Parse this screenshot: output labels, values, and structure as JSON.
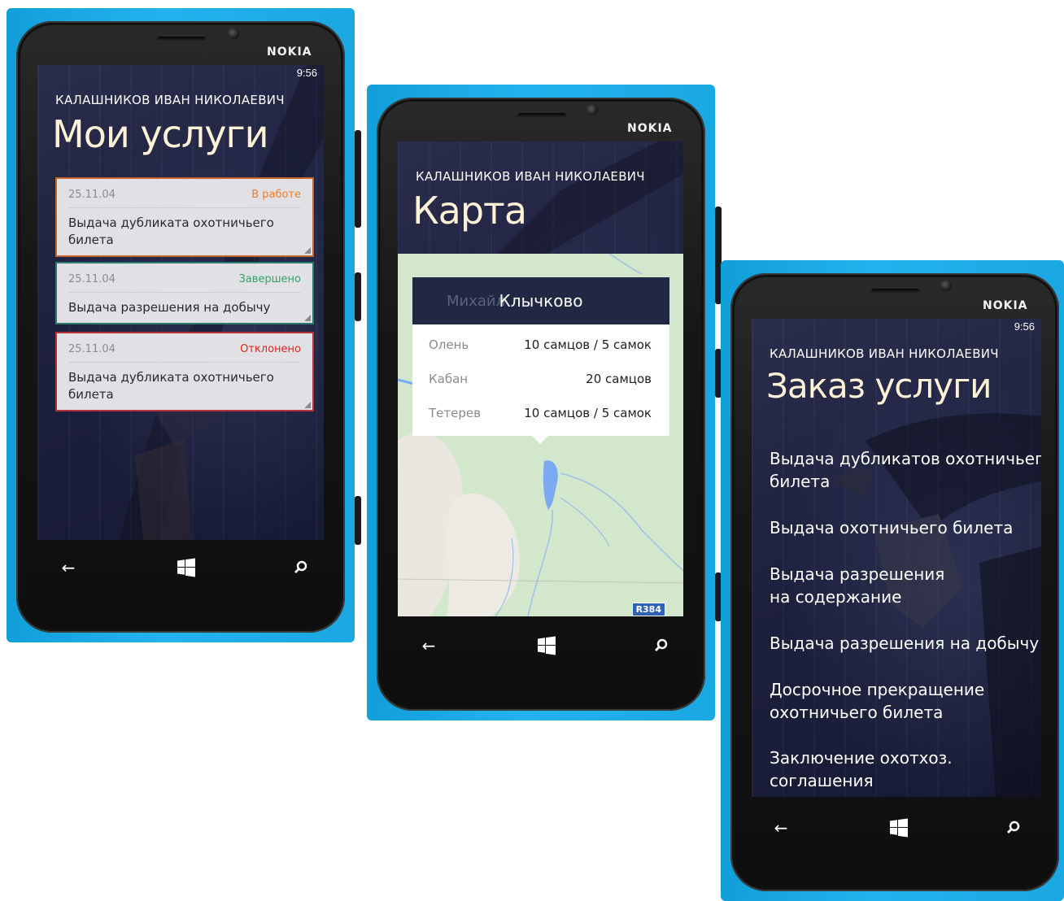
{
  "phone_brand": "NOKIA",
  "phone1": {
    "time": "9:56",
    "user": "КАЛАШНИКОВ ИВАН НИКОЛАЕВИЧ",
    "title": "Мои услуги",
    "cards": [
      {
        "date": "25.11.04",
        "status": "В работе",
        "status_color": "#f07c2a",
        "border_color": "#c4662b",
        "title_line1": "Выдача дубликата охотничьего",
        "title_line2": "билета"
      },
      {
        "date": "25.11.04",
        "status": "Завершено",
        "status_color": "#2aa56c",
        "border_color": "#2b7a6d",
        "title_line1": "Выдача разрешения на добычу",
        "title_line2": ""
      },
      {
        "date": "25.11.04",
        "status": "Отклонено",
        "status_color": "#e2231a",
        "border_color": "#b8323a",
        "title_line1": "Выдача дубликата охотничьего",
        "title_line2": "билета"
      }
    ]
  },
  "phone2": {
    "user": "КАЛАШНИКОВ ИВАН НИКОЛАЕВИЧ",
    "title": "Карта",
    "popup_ghost_text": "Михайл",
    "popup_title": "Клычково",
    "rows": [
      {
        "animal": "Олень",
        "count": "10 самцов / 5 самок"
      },
      {
        "animal": "Кабан",
        "count": "20 самцов"
      },
      {
        "animal": "Тетерев",
        "count": "10 самцов / 5 самок"
      }
    ],
    "road_label": "R384"
  },
  "phone3": {
    "time": "9:56",
    "user": "КАЛАШНИКОВ ИВАН НИКОЛАЕВИЧ",
    "title": "Заказ услуги",
    "menu": [
      {
        "line1": "Выдача дубликатов охотничьего",
        "line2": "билета"
      },
      {
        "line1": "Выдача охотничьего билета",
        "line2": ""
      },
      {
        "line1": "Выдача разрешения",
        "line2": "на содержание"
      },
      {
        "line1": "Выдача разрешения на добычу",
        "line2": ""
      },
      {
        "line1": "Досрочное прекращение",
        "line2": "охотничьего билета"
      },
      {
        "line1": "Заключение охотхоз.",
        "line2": "соглашения"
      }
    ]
  },
  "icons": {
    "back": "back-arrow-icon",
    "start": "windows-start-icon",
    "search": "search-icon"
  }
}
